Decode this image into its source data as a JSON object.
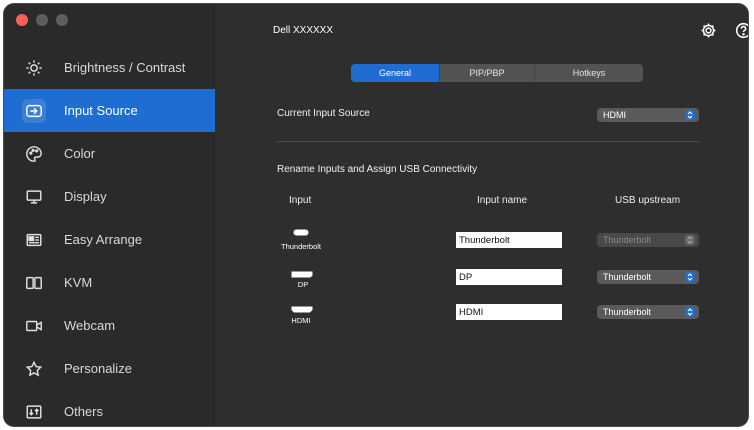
{
  "window": {
    "title": "Dell XXXXXX"
  },
  "sidebar": {
    "items": [
      {
        "label": "Brightness / Contrast",
        "icon": "sun-icon"
      },
      {
        "label": "Input Source",
        "icon": "input-source-icon"
      },
      {
        "label": "Color",
        "icon": "palette-icon"
      },
      {
        "label": "Display",
        "icon": "monitor-icon"
      },
      {
        "label": "Easy Arrange",
        "icon": "layout-icon"
      },
      {
        "label": "KVM",
        "icon": "kvm-icon"
      },
      {
        "label": "Webcam",
        "icon": "webcam-icon"
      },
      {
        "label": "Personalize",
        "icon": "star-icon"
      },
      {
        "label": "Others",
        "icon": "others-icon"
      }
    ],
    "active_index": 1
  },
  "tabs": [
    "General",
    "PIP/PBP",
    "Hotkeys"
  ],
  "current_input": {
    "label": "Current Input Source",
    "value": "HDMI"
  },
  "rename_section": {
    "title": "Rename Inputs and Assign USB Connectivity"
  },
  "table": {
    "headers": {
      "input": "Input",
      "input_name": "Input name",
      "usb": "USB upstream"
    },
    "rows": [
      {
        "port_label": "Thunderbolt",
        "name": "Thunderbolt",
        "usb": "Thunderbolt",
        "usb_disabled": true
      },
      {
        "port_label": "DP",
        "name": "DP",
        "usb": "Thunderbolt",
        "usb_disabled": false
      },
      {
        "port_label": "HDMI",
        "name": "HDMI",
        "usb": "Thunderbolt",
        "usb_disabled": false
      }
    ]
  },
  "colors": {
    "accent": "#1f6dd0",
    "background": "#2f2e2e",
    "sidebar": "#2a2a2a"
  }
}
